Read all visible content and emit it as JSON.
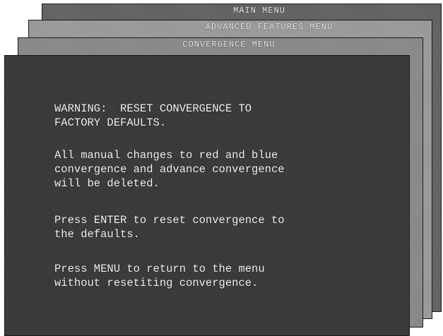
{
  "menus": {
    "main": {
      "title": "MAIN MENU"
    },
    "advanced": {
      "title": "ADVANCED FEATURES MENU"
    },
    "convergence": {
      "title": "CONVERGENCE MENU"
    }
  },
  "dialog": {
    "warning": "WARNING:  RESET CONVERGENCE TO\nFACTORY DEFAULTS.",
    "changes": "All manual changes to red and blue\nconvergence and advance convergence\nwill be deleted.",
    "enter": "Press ENTER to reset convergence to\nthe defaults.",
    "menu": "Press MENU to return to the menu\nwithout resetiting convergence."
  },
  "colors": {
    "dialog_background": "#3c3c3c",
    "text": "#f4f4f4"
  }
}
